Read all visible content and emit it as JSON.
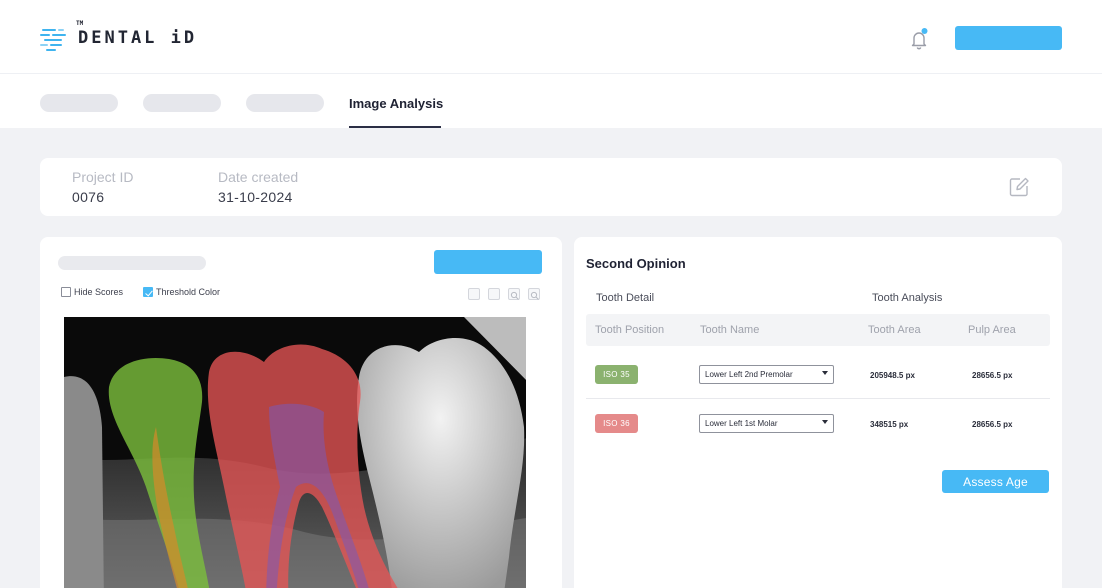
{
  "brand": {
    "name": "DENTAL iD",
    "trademark": "TM",
    "accent_color": "#47b9f5"
  },
  "header": {
    "notification_icon": "bell-icon",
    "has_notification_dot": true
  },
  "tabs": {
    "active_label": "Image Analysis"
  },
  "project": {
    "id_label": "Project ID",
    "id_value": "0076",
    "date_label": "Date created",
    "date_value": "31-10-2024",
    "edit_icon": "edit-icon"
  },
  "viewer": {
    "hide_scores_label": "Hide Scores",
    "hide_scores_checked": false,
    "threshold_color_label": "Threshold Color",
    "threshold_color_checked": true,
    "tool_icons": [
      "fit-icon",
      "expand-icon",
      "zoom-in-icon",
      "zoom-out-icon"
    ]
  },
  "second_opinion": {
    "title": "Second Opinion",
    "tooth_detail_label": "Tooth Detail",
    "tooth_analysis_label": "Tooth Analysis",
    "columns": [
      "Tooth Position",
      "Tooth Name",
      "Tooth Area",
      "Pulp Area"
    ],
    "rows": [
      {
        "position": "ISO 35",
        "badge_color": "#8bb26f",
        "name": "Lower Left 2nd Premolar",
        "tooth_area": "205948.5 px",
        "pulp_area": "28656.5 px"
      },
      {
        "position": "ISO 36",
        "badge_color": "#e58a8a",
        "name": "Lower Left 1st Molar",
        "tooth_area": "348515 px",
        "pulp_area": "28656.5 px"
      }
    ],
    "assess_button": "Assess Age"
  }
}
